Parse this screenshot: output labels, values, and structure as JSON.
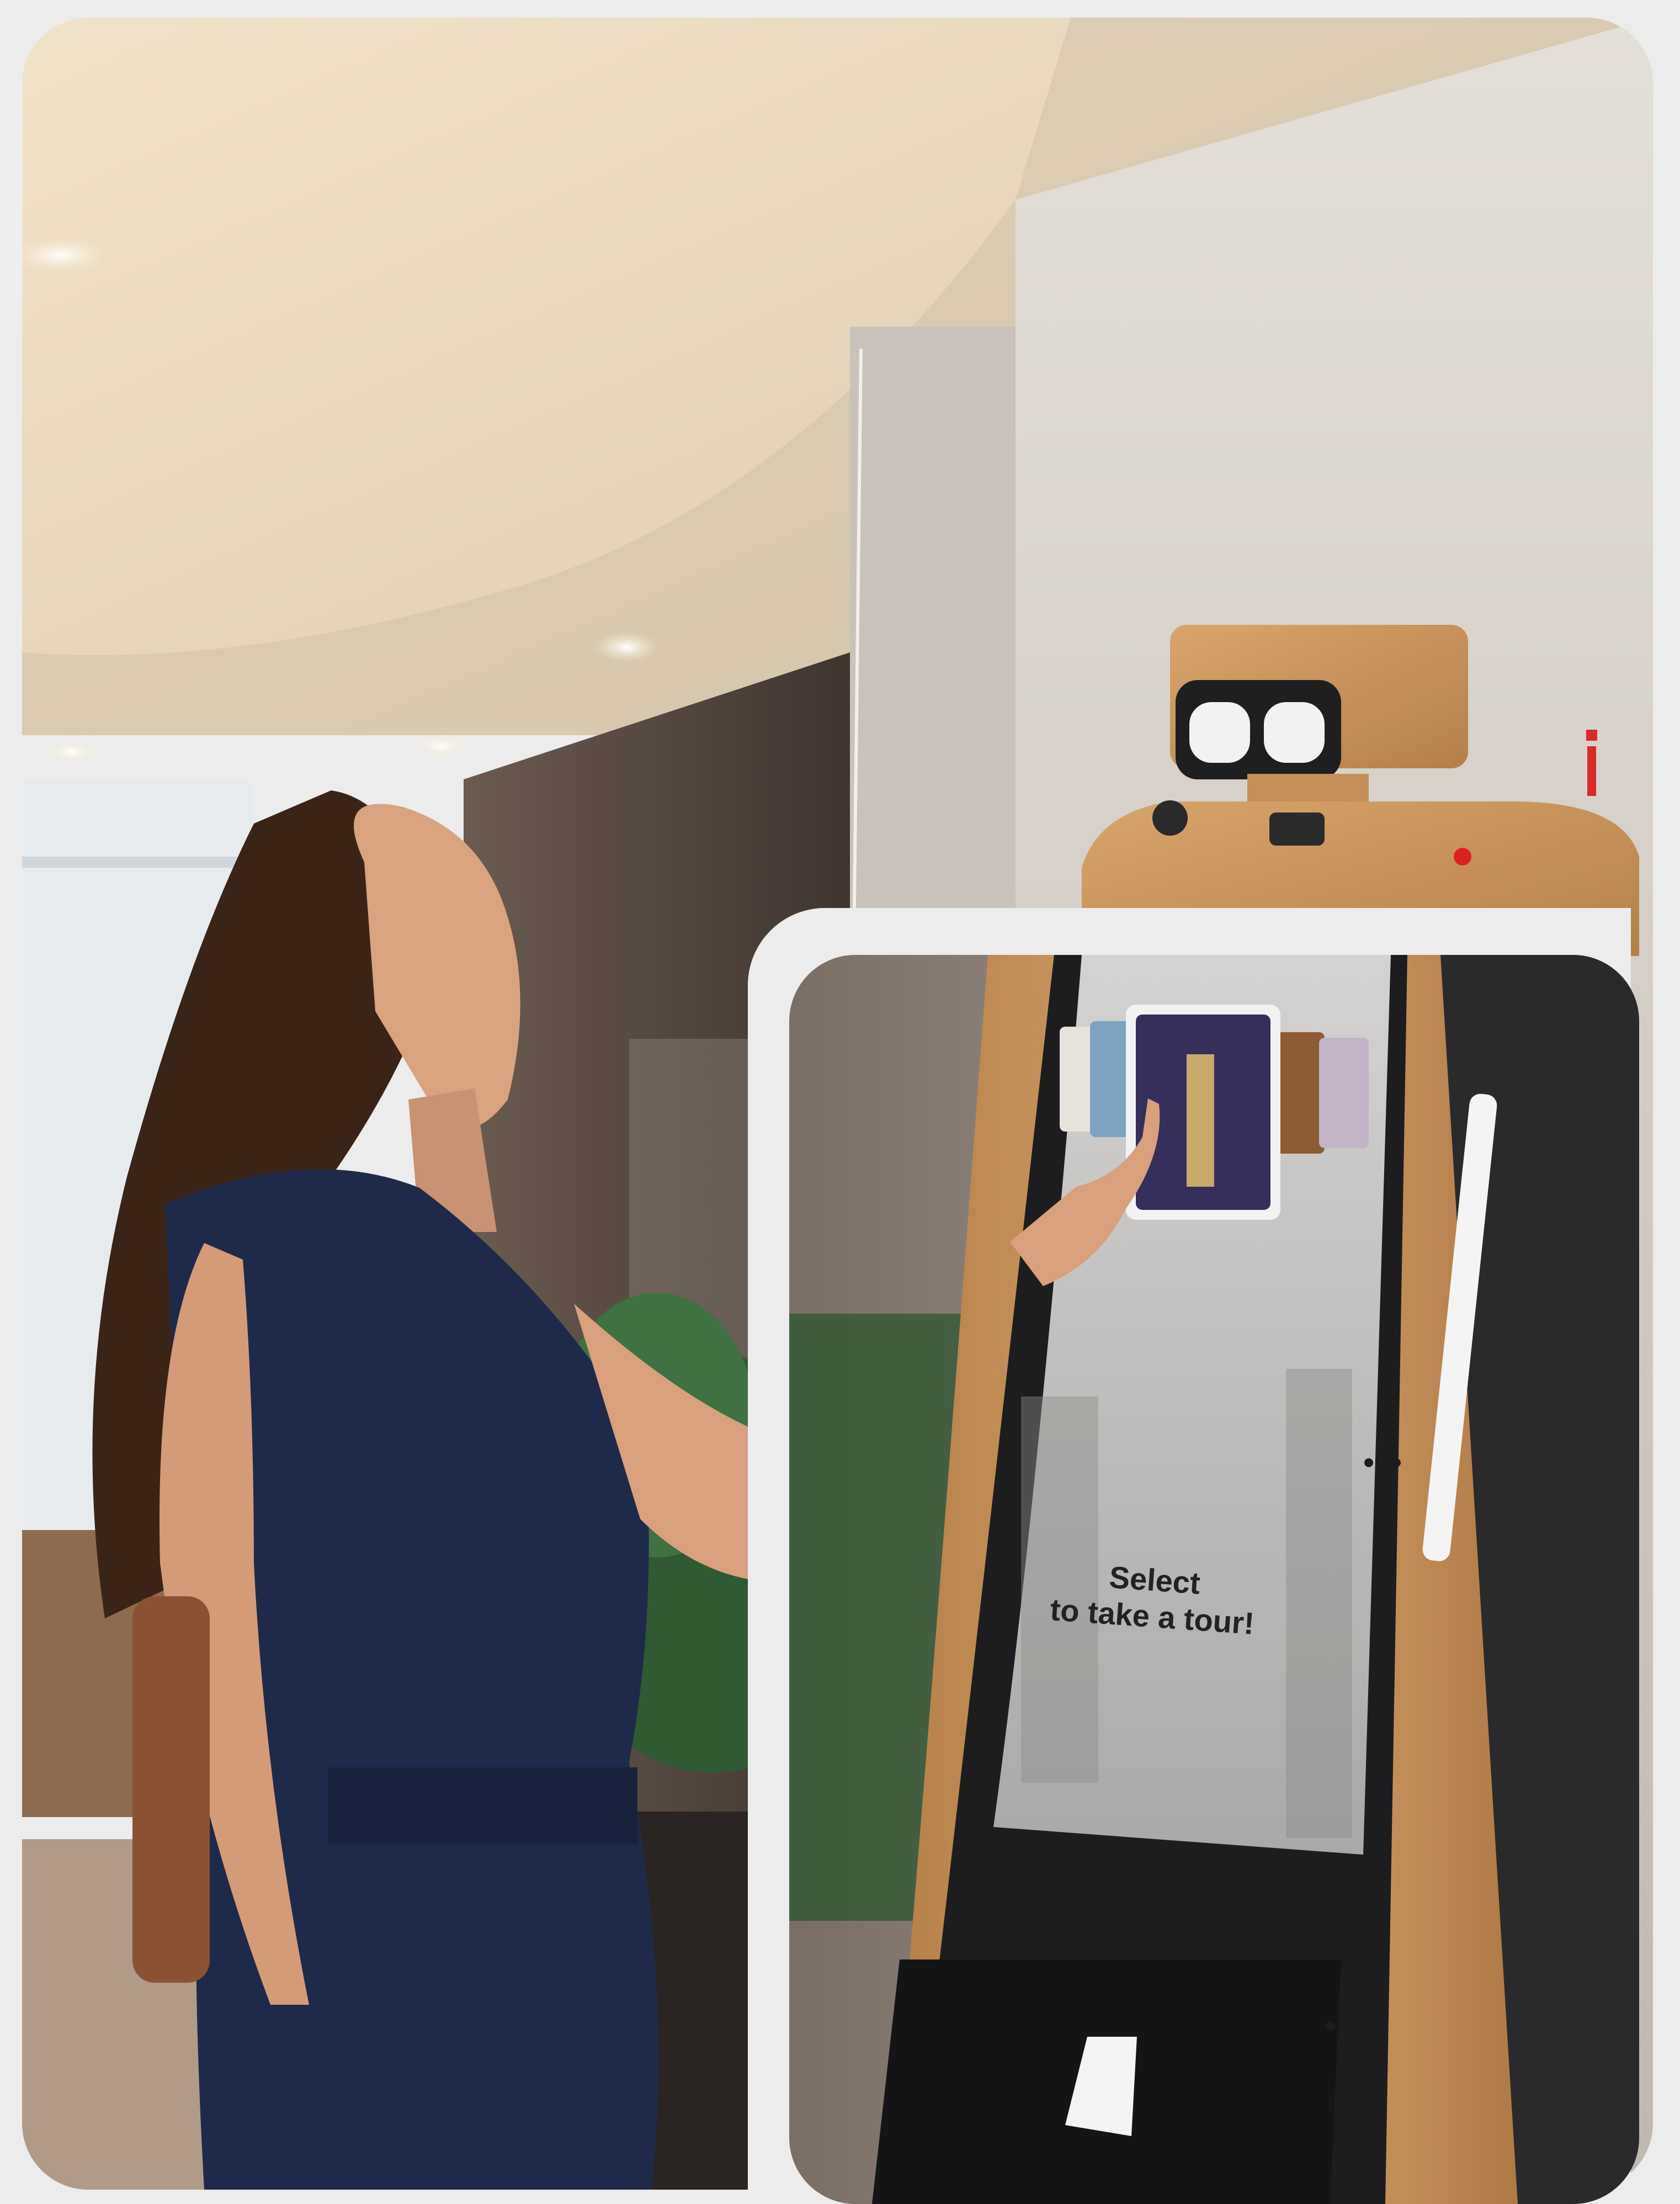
{
  "kiosk_screen": {
    "line1": "Select",
    "line2": "to take a tour!"
  },
  "colors": {
    "background": "#ececec",
    "robot_body": "#c9955e",
    "screen_bezel": "#1d1d1f",
    "dress": "#1f2a4a",
    "ceiling": "#f3e6cf",
    "wall": "#d8d3cc"
  },
  "icons": {
    "info_marker": "info-icon",
    "indicator_light": "red-dot-icon"
  }
}
